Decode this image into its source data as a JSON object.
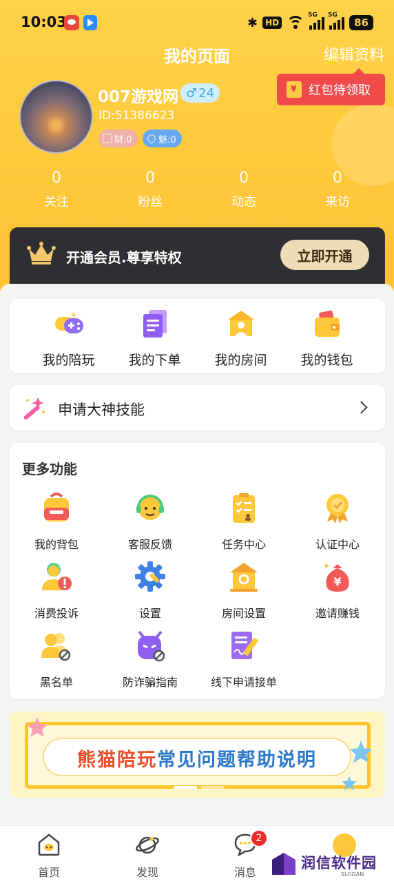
{
  "status_bar": {
    "time": "10:03",
    "battery": "86",
    "bluetooth": "✱",
    "hd": "HD",
    "net1": "5G",
    "net2": "5G"
  },
  "header": {
    "title": "我的页面",
    "edit": "编辑资料",
    "red_packet": "红包待领取"
  },
  "profile": {
    "nickname": "007游戏网",
    "gender_symbol": "♂",
    "age": "24",
    "id": "ID:51386623",
    "wealth": "财:0",
    "charm": "魅:0"
  },
  "stats": [
    {
      "value": "0",
      "label": "关注"
    },
    {
      "value": "0",
      "label": "粉丝"
    },
    {
      "value": "0",
      "label": "动态"
    },
    {
      "value": "0",
      "label": "来访"
    }
  ],
  "vip": {
    "text": "开通会员.尊享特权",
    "button": "立即开通"
  },
  "quick_actions": [
    {
      "label": "我的陪玩",
      "icon": "gamepad-icon"
    },
    {
      "label": "我的下单",
      "icon": "orders-icon"
    },
    {
      "label": "我的房间",
      "icon": "room-icon"
    },
    {
      "label": "我的钱包",
      "icon": "wallet-icon"
    }
  ],
  "god_skill": {
    "label": "申请大神技能"
  },
  "more": {
    "title": "更多功能",
    "items": [
      {
        "label": "我的背包",
        "icon": "backpack-icon"
      },
      {
        "label": "客服反馈",
        "icon": "customer-service-icon"
      },
      {
        "label": "任务中心",
        "icon": "task-icon"
      },
      {
        "label": "认证中心",
        "icon": "certification-icon"
      },
      {
        "label": "消费投诉",
        "icon": "complaint-icon"
      },
      {
        "label": "设置",
        "icon": "gear-icon"
      },
      {
        "label": "房间设置",
        "icon": "room-settings-icon"
      },
      {
        "label": "邀请赚钱",
        "icon": "money-bag-icon"
      },
      {
        "label": "黑名单",
        "icon": "blacklist-icon"
      },
      {
        "label": "防诈骗指南",
        "icon": "anti-fraud-icon"
      },
      {
        "label": "线下申请接单",
        "icon": "offline-apply-icon"
      }
    ]
  },
  "banner": {
    "part1": "熊猫陪玩",
    "part2": "常见问题帮助说明"
  },
  "tabbar": [
    {
      "label": "首页",
      "icon": "home-icon"
    },
    {
      "label": "发现",
      "icon": "discover-icon"
    },
    {
      "label": "消息",
      "icon": "message-icon",
      "badge": "2"
    },
    {
      "label": "",
      "icon": "profile-icon"
    }
  ],
  "watermark": {
    "text": "润信软件园",
    "sub": "SLOGAN"
  },
  "colors": {
    "accent": "#ffc93a",
    "vip_bg": "#2f2f33",
    "red": "#f04a4a"
  }
}
